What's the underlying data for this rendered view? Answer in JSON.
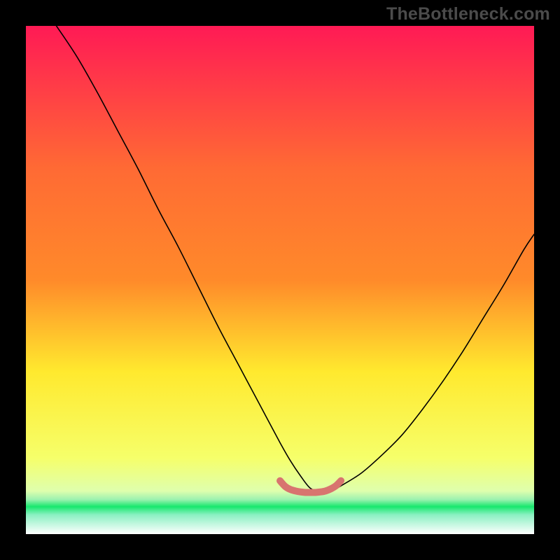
{
  "watermark": "TheBottleneck.com",
  "chart_data": {
    "type": "line",
    "title": "",
    "xlabel": "",
    "ylabel": "",
    "xlim": [
      0,
      100
    ],
    "ylim": [
      0,
      100
    ],
    "grid": false,
    "legend": false,
    "background_gradient": {
      "top_color": "#ff1a55",
      "mid_upper_color": "#ff8a2a",
      "mid_color": "#ffe92e",
      "mid_lower_color": "#f6ff6a",
      "green_band_color": "#17e86d",
      "bottom_color": "#ffffff"
    },
    "series": [
      {
        "name": "bottleneck-curve",
        "color": "#000000",
        "x": [
          6,
          10,
          14,
          18,
          22,
          26,
          30,
          34,
          38,
          42,
          46,
          50,
          52,
          54,
          56,
          58,
          60,
          62,
          66,
          70,
          74,
          78,
          82,
          86,
          90,
          94,
          98,
          100
        ],
        "y": [
          100,
          94,
          87,
          79.5,
          72,
          64,
          56.5,
          48.5,
          40.5,
          33,
          25.5,
          18,
          14.5,
          11.5,
          9,
          8.5,
          8.5,
          9.5,
          12,
          15.5,
          19.5,
          24.5,
          30,
          36,
          42.5,
          49,
          56,
          59
        ]
      },
      {
        "name": "optimal-marker",
        "color": "#d8746f",
        "x": [
          50,
          51,
          52,
          53,
          54,
          55,
          56,
          57,
          58,
          59,
          60,
          61,
          62
        ],
        "y": [
          10.5,
          9.4,
          8.8,
          8.5,
          8.3,
          8.2,
          8.2,
          8.2,
          8.3,
          8.5,
          8.9,
          9.5,
          10.5
        ]
      }
    ]
  }
}
